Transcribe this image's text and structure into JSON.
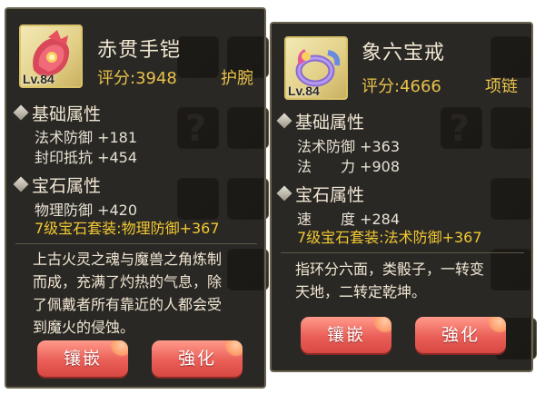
{
  "tooltips": [
    {
      "item_name": "赤贯手铠",
      "level": "Lv.84",
      "score": "评分:3948",
      "slot": "护腕",
      "base_title": "基础属性",
      "base_stats": [
        "法术防御 +181",
        "封印抵抗 +454"
      ],
      "gem_title": "宝石属性",
      "gem_stats": [
        "物理防御 +420"
      ],
      "gem_set": "7级宝石套装:物理防御+367",
      "description": [
        "上古火灵之魂与魔兽之角炼制",
        "而成，充满了灼热的气息，除",
        "了佩戴者所有靠近的人都会受",
        "到魔火的侵蚀。"
      ],
      "buttons": {
        "inlay": "镶嵌",
        "enhance": "強化"
      },
      "icon": "gauntlet-icon"
    },
    {
      "item_name": "象六宝戒",
      "level": "Lv.84",
      "score": "评分:4666",
      "slot": "项链",
      "base_title": "基础属性",
      "base_stats": [
        "法术防御 +363",
        "法　　力 +908"
      ],
      "gem_title": "宝石属性",
      "gem_stats": [
        "速　　度 +284"
      ],
      "gem_set": "7级宝石套装:法术防御+367",
      "description": [
        "指环分六面，类骰子，一转变",
        "天地，二转定乾坤。"
      ],
      "buttons": {
        "inlay": "镶嵌",
        "enhance": "強化"
      },
      "icon": "ring-icon"
    }
  ],
  "colors": {
    "name": "#f0e6d2",
    "score": "#e8c24a",
    "set": "#f2c832",
    "button": "#ea5f58",
    "panel": "#1a1814"
  }
}
